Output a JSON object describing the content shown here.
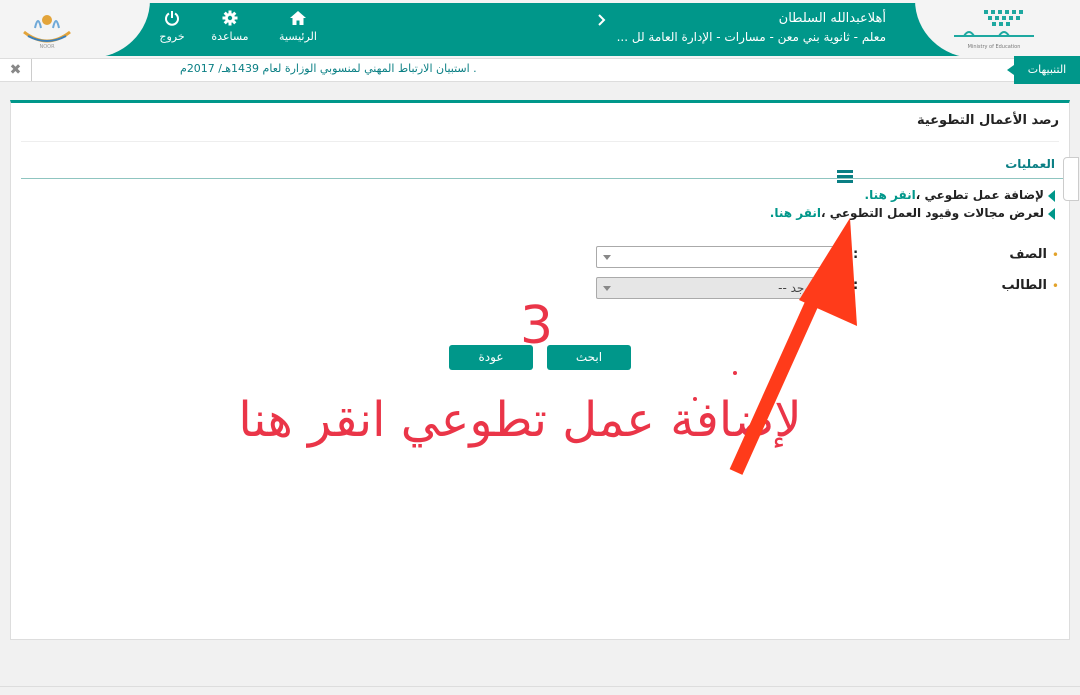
{
  "header": {
    "user_greeting": "أهلاعبدالله السلطان",
    "user_role": "معلم - ثانوية بني معن - مسارات - الإدارة العامة لل ...",
    "nav": {
      "home_label": "الرئيسية",
      "help_label": "مساعدة",
      "logout_label": "خروج"
    },
    "icons": [
      "home-icon",
      "gear-icon",
      "power-icon",
      "chevron-right-icon"
    ],
    "accent_color": "#00978a"
  },
  "alerts": {
    "tab_label": "التنبيهات",
    "close_glyph": "✖",
    "message": ". استبيان الارتباط المهني لمنسوبي الوزارة لعام 1439هـ/ 2017م"
  },
  "page": {
    "title": "رصد الأعمال التطوعية",
    "operations_title": "العمليات",
    "link1_text": "لإضافة عمل تطوعي ،",
    "link1_action": "انقر هنا.",
    "link2_text": "لعرض مجالات وقيود العمل التطوعي ،",
    "link2_action": "انقر هنا.",
    "grade_label": "الصف",
    "student_label": "الطالب",
    "grade_value": "--",
    "student_value": "-- لا يوجد --",
    "search_button": "ابحث",
    "back_button": "عودة"
  },
  "annotation": {
    "step_number": "3",
    "caption": "لإضافة عمل تطوعي انقر هنا",
    "color": "#ea3548"
  }
}
